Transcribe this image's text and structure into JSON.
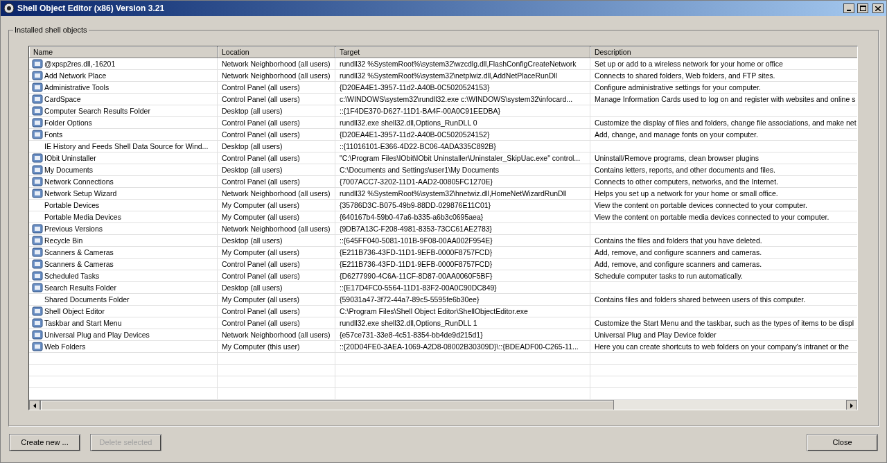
{
  "window": {
    "title": "Shell Object Editor (x86) Version 3.21"
  },
  "group": {
    "label": "Installed shell objects"
  },
  "table": {
    "columns": [
      "Name",
      "Location",
      "Target",
      "Description"
    ],
    "rows": [
      {
        "has_icon": true,
        "cells": [
          "@xpsp2res.dll,-16201",
          "Network Neighborhood (all users)",
          "rundll32 %SystemRoot%\\system32\\wzcdlg.dll,FlashConfigCreateNetwork",
          "Set up or add to a wireless network for your home or office"
        ]
      },
      {
        "has_icon": true,
        "cells": [
          "Add Network Place",
          "Network Neighborhood (all users)",
          "rundll32 %SystemRoot%\\system32\\netplwiz.dll,AddNetPlaceRunDll",
          "Connects to shared folders, Web folders, and FTP sites."
        ]
      },
      {
        "has_icon": true,
        "cells": [
          "Administrative Tools",
          "Control Panel (all users)",
          "{D20EA4E1-3957-11d2-A40B-0C5020524153}",
          "Configure administrative settings for your computer."
        ]
      },
      {
        "has_icon": true,
        "cells": [
          "CardSpace",
          "Control Panel (all users)",
          "c:\\WINDOWS\\system32\\rundll32.exe c:\\WINDOWS\\system32\\infocard...",
          "Manage Information Cards used to log on and register with websites and online s"
        ]
      },
      {
        "has_icon": true,
        "cells": [
          "Computer Search Results Folder",
          "Desktop (all users)",
          "::{1F4DE370-D627-11D1-BA4F-00A0C91EEDBA}",
          ""
        ]
      },
      {
        "has_icon": true,
        "cells": [
          "Folder Options",
          "Control Panel (all users)",
          "rundll32.exe shell32.dll,Options_RunDLL 0",
          "Customize the display of files and folders, change file associations, and make net"
        ]
      },
      {
        "has_icon": true,
        "cells": [
          "Fonts",
          "Control Panel (all users)",
          "{D20EA4E1-3957-11d2-A40B-0C5020524152}",
          "Add, change, and manage fonts on your computer."
        ]
      },
      {
        "has_icon": false,
        "cells": [
          "IE History and Feeds Shell Data Source for Wind...",
          "Desktop (all users)",
          "::{11016101-E366-4D22-BC06-4ADA335C892B}",
          ""
        ]
      },
      {
        "has_icon": true,
        "cells": [
          "IObit Uninstaller",
          "Control Panel (all users)",
          "\"C:\\Program Files\\IObit\\IObit Uninstaller\\Uninstaler_SkipUac.exe\" control...",
          "Uninstall/Remove programs, clean browser plugins"
        ]
      },
      {
        "has_icon": true,
        "cells": [
          "My Documents",
          "Desktop (all users)",
          "C:\\Documents and Settings\\user1\\My Documents",
          "Contains letters, reports, and other documents and files."
        ]
      },
      {
        "has_icon": true,
        "cells": [
          "Network Connections",
          "Control Panel (all users)",
          "{7007ACC7-3202-11D1-AAD2-00805FC1270E}",
          "Connects to other computers, networks, and the Internet."
        ]
      },
      {
        "has_icon": true,
        "cells": [
          "Network Setup Wizard",
          "Network Neighborhood (all users)",
          "rundll32 %SystemRoot%\\system32\\hnetwiz.dll,HomeNetWizardRunDll",
          "Helps you set up a network for your home or small office."
        ]
      },
      {
        "has_icon": false,
        "cells": [
          "Portable Devices",
          "My Computer (all users)",
          "{35786D3C-B075-49b9-88DD-029876E11C01}",
          "View the content on portable devices connected to your computer."
        ]
      },
      {
        "has_icon": false,
        "cells": [
          "Portable Media Devices",
          "My Computer (all users)",
          "{640167b4-59b0-47a6-b335-a6b3c0695aea}",
          "View the content on portable media devices connected to your computer."
        ]
      },
      {
        "has_icon": true,
        "cells": [
          "Previous Versions",
          "Network Neighborhood (all users)",
          "{9DB7A13C-F208-4981-8353-73CC61AE2783}",
          ""
        ]
      },
      {
        "has_icon": true,
        "cells": [
          "Recycle Bin",
          "Desktop (all users)",
          "::{645FF040-5081-101B-9F08-00AA002F954E}",
          "Contains the files and folders that you have deleted."
        ]
      },
      {
        "has_icon": true,
        "cells": [
          "Scanners & Cameras",
          "My Computer (all users)",
          "{E211B736-43FD-11D1-9EFB-0000F8757FCD}",
          "Add, remove, and configure scanners and cameras."
        ]
      },
      {
        "has_icon": true,
        "cells": [
          "Scanners & Cameras",
          "Control Panel (all users)",
          "{E211B736-43FD-11D1-9EFB-0000F8757FCD}",
          "Add, remove, and configure scanners and cameras."
        ]
      },
      {
        "has_icon": true,
        "cells": [
          "Scheduled Tasks",
          "Control Panel (all users)",
          "{D6277990-4C6A-11CF-8D87-00AA0060F5BF}",
          "Schedule computer tasks to run automatically."
        ]
      },
      {
        "has_icon": true,
        "cells": [
          "Search Results Folder",
          "Desktop (all users)",
          "::{E17D4FC0-5564-11D1-83F2-00A0C90DC849}",
          ""
        ]
      },
      {
        "has_icon": false,
        "cells": [
          "Shared Documents Folder",
          "My Computer (all users)",
          "{59031a47-3f72-44a7-89c5-5595fe6b30ee}",
          "Contains files and folders shared between users of this computer."
        ]
      },
      {
        "has_icon": true,
        "cells": [
          "Shell Object Editor",
          "Control Panel (all users)",
          "C:\\Program Files\\Shell Object Editor\\ShellObjectEditor.exe",
          ""
        ]
      },
      {
        "has_icon": true,
        "cells": [
          "Taskbar and Start Menu",
          "Control Panel (all users)",
          "rundll32.exe shell32.dll,Options_RunDLL 1",
          "Customize the Start Menu and the taskbar, such as the types of items to be displ"
        ]
      },
      {
        "has_icon": true,
        "cells": [
          "Universal Plug and Play Devices",
          "Network Neighborhood (all users)",
          "{e57ce731-33e8-4c51-8354-bb4de9d215d1}",
          "Universal Plug and Play Device folder"
        ]
      },
      {
        "has_icon": true,
        "cells": [
          "Web Folders",
          "My Computer (this user)",
          "::{20D04FE0-3AEA-1069-A2D8-08002B30309D}\\::{BDEADF00-C265-11...",
          "Here you can create shortcuts to web folders on your company's intranet or the"
        ]
      }
    ]
  },
  "buttons": [
    {
      "label": "Create new ...",
      "disabled": false
    },
    {
      "label": "Delete selected",
      "disabled": true
    },
    {
      "label": "Close",
      "disabled": false
    }
  ]
}
